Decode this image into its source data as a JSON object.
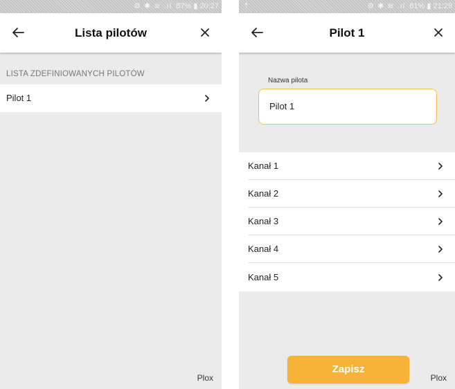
{
  "left": {
    "status": {
      "battery": "87%",
      "time": "20:27",
      "icons": "⚙ ✱ ≋ .ıl"
    },
    "appbar": {
      "title": "Lista pilotów"
    },
    "section_header": "LISTA ZDEFINIOWANYCH PILOTÓW",
    "items": [
      {
        "label": "Pilot 1"
      }
    ],
    "brand": "Plox"
  },
  "right": {
    "status": {
      "left_icon": "⇡",
      "battery": "81%",
      "time": "21:29",
      "icons": "⚙ ✱ ≋ .ıl"
    },
    "appbar": {
      "title": "Pilot 1"
    },
    "field": {
      "label": "Nazwa pilota",
      "value": "Pilot 1"
    },
    "channels": [
      {
        "label": "Kanał 1"
      },
      {
        "label": "Kanał 2"
      },
      {
        "label": "Kanał 3"
      },
      {
        "label": "Kanał 4"
      },
      {
        "label": "Kanał 5"
      }
    ],
    "save_label": "Zapisz",
    "brand": "Plox"
  },
  "colors": {
    "accent": "#f7b335",
    "input_border": "#f4c04a",
    "background": "#ebebeb"
  },
  "icons": [
    "back-arrow-icon",
    "close-icon",
    "chevron-right-icon",
    "battery-icon",
    "signal-icon"
  ]
}
